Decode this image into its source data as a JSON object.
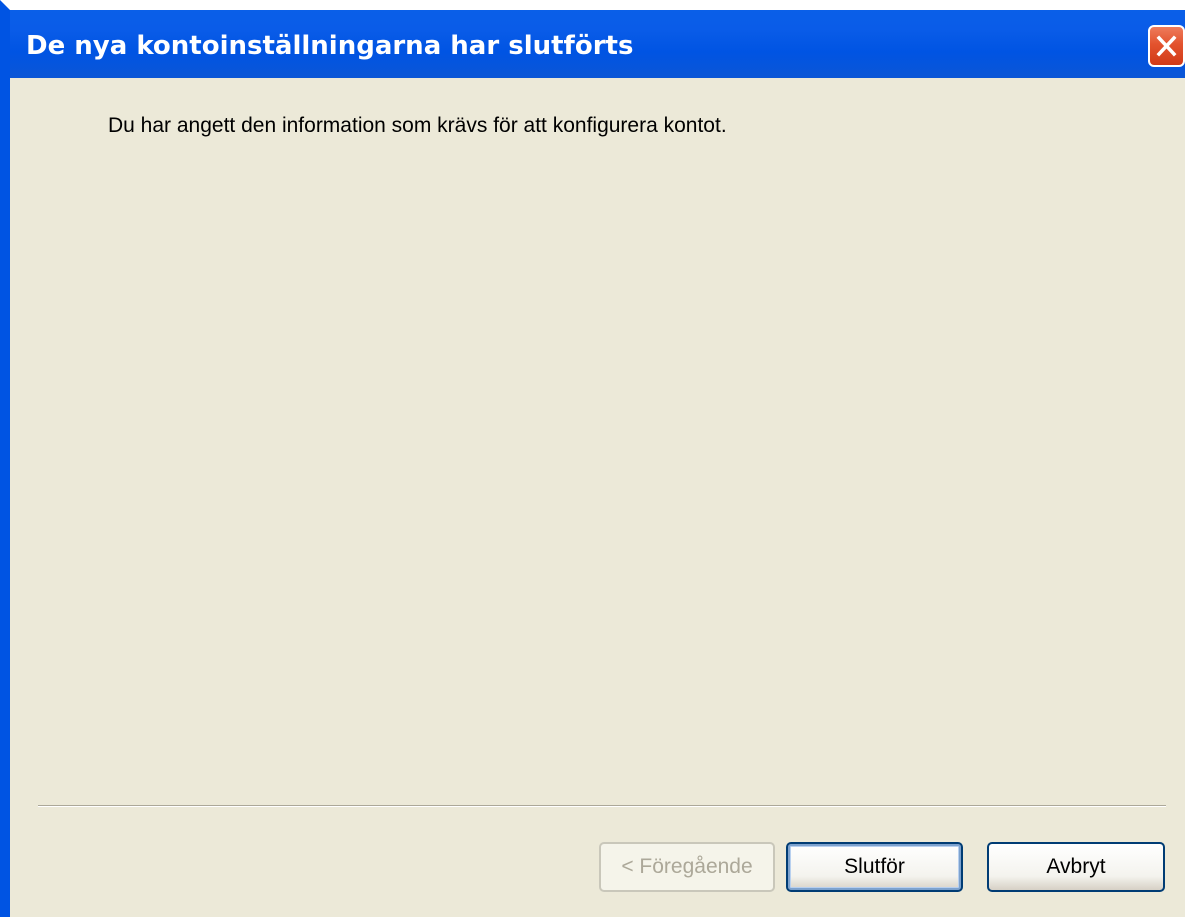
{
  "window": {
    "title": "De nya kontoinställningarna har slutförts"
  },
  "content": {
    "message": "Du har angett den information som krävs för att konfigurera kontot."
  },
  "buttons": {
    "previous_label": "< Föregående",
    "finish_label": "Slutför",
    "cancel_label": "Avbryt"
  },
  "icons": {
    "close": "close-icon"
  },
  "colors": {
    "titlebar": "#0054e3",
    "close_button": "#e3532e",
    "dialog_background": "#ece9d8",
    "button_border": "#003c74",
    "disabled_text": "#aca899"
  },
  "state": {
    "previous_enabled": false,
    "default_button": "finish"
  }
}
